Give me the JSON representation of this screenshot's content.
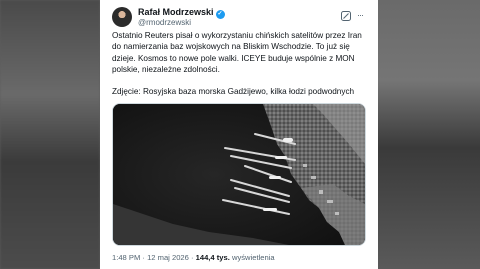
{
  "tweet": {
    "author_name": "Rafał Modrzewski",
    "author_handle": "@rmodrzewski",
    "paragraphs": [
      "Ostatnio Reuters pisał o wykorzystaniu chińskich satelitów przez Iran do namierzania baz wojskowych na Bliskim Wschodzie. To już się dzieje. Kosmos to nowe pole walki. ICEYE buduje wspólnie z MON polskie, niezależne zdolności.",
      "Zdjęcie: Rosyjska baza morska Gadżijewo, kilka łodzi podwodnych"
    ],
    "time": "1:48 PM",
    "date": "12 maj 2026",
    "separator": "·",
    "views_count": "144,4 tys.",
    "views_label": "wyświetlenia"
  },
  "icons": {
    "verified": "verified-badge-icon",
    "grok": "grok-icon",
    "more": "more-options-icon"
  },
  "colors": {
    "text": "#0f1419",
    "secondary": "#536471",
    "verified": "#1d9bf0"
  }
}
